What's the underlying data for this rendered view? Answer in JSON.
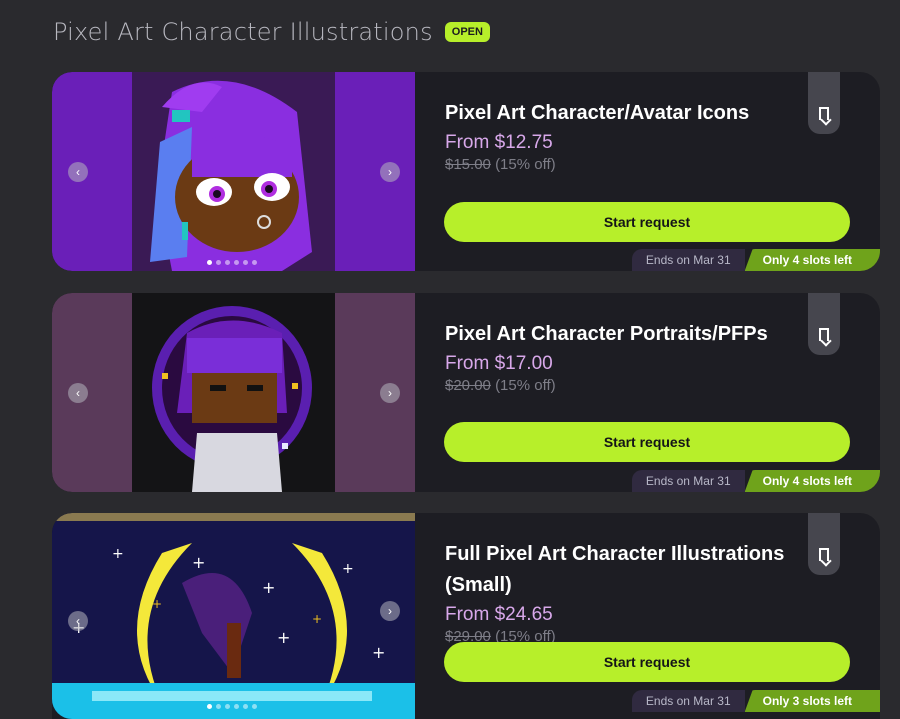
{
  "header": {
    "title": "Pixel Art Character Illustrations",
    "badge": "OPEN"
  },
  "colors": {
    "accent": "#b7ef2a",
    "price": "#d8a8ea",
    "slots": "#6fa31b",
    "card": "#1d1d23"
  },
  "cards": [
    {
      "title": "Pixel Art Character/Avatar Icons",
      "price": "From $12.75",
      "original_price": "$15.00",
      "discount": "(15% off)",
      "button": "Start request",
      "ends": "Ends on Mar 31",
      "slots": "Only 4 slots left",
      "image_dots": 6,
      "active_dot": 0
    },
    {
      "title": "Pixel Art Character Portraits/PFPs",
      "price": "From $17.00",
      "original_price": "$20.00",
      "discount": "(15% off)",
      "button": "Start request",
      "ends": "Ends on Mar 31",
      "slots": "Only 4 slots left"
    },
    {
      "title": "Full Pixel Art Character Illustrations (Small)",
      "price": "From $24.65",
      "original_price": "$29.00",
      "discount": "(15% off)",
      "button": "Start request",
      "ends": "Ends on Mar 31",
      "slots": "Only 3 slots left",
      "image_dots": 6,
      "active_dot": 0
    }
  ],
  "icons": {
    "prev": "chevron-left-icon",
    "next": "chevron-right-icon",
    "bookmark": "bookmark-icon"
  }
}
